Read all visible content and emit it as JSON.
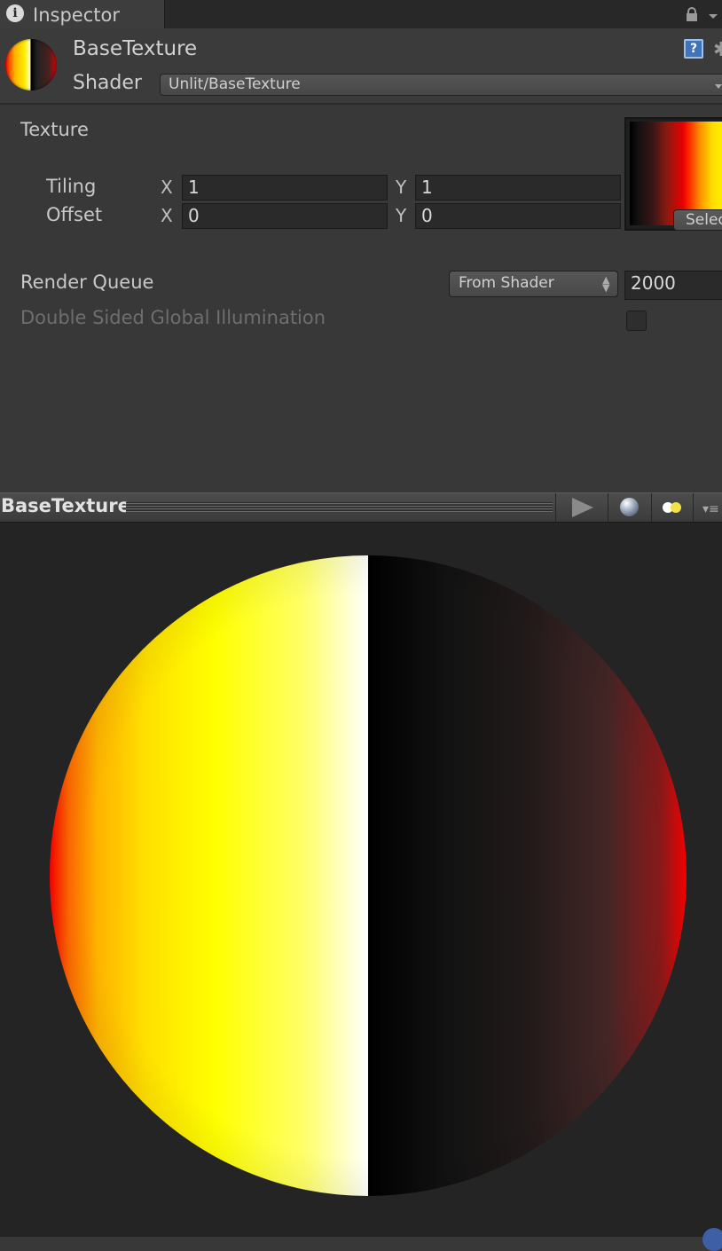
{
  "tab": {
    "icon": "info-icon",
    "label": "Inspector",
    "lock_icon": "lock-icon",
    "menu_icon": "chevron-down-icon"
  },
  "header": {
    "material_name": "BaseTexture",
    "shader_label": "Shader",
    "shader_value": "Unlit/BaseTexture",
    "help_icon": "help-icon",
    "help_glyph": "?",
    "settings_icon": "gear-icon"
  },
  "texture": {
    "label": "Texture",
    "tiling_label": "Tiling",
    "offset_label": "Offset",
    "axis_x": "X",
    "axis_y": "Y",
    "tiling_x": "1",
    "tiling_y": "1",
    "offset_x": "0",
    "offset_y": "0",
    "select_button": "Select"
  },
  "render_queue": {
    "label": "Render Queue",
    "mode": "From Shader",
    "value": "2000"
  },
  "double_sided_gi": {
    "label": "Double Sided Global Illumination",
    "checked": false
  },
  "preview": {
    "title": "BaseTexture",
    "play_icon": "play-icon",
    "mesh_icon": "sphere-icon",
    "light_icon": "light-icon",
    "options_icon": "menu-icon",
    "options_glyph": "▾≡"
  },
  "colors": {
    "panel": "#383838",
    "preview_bg": "#242424",
    "texture_gradient": [
      "#000000",
      "#e80000",
      "#ffff00"
    ]
  }
}
